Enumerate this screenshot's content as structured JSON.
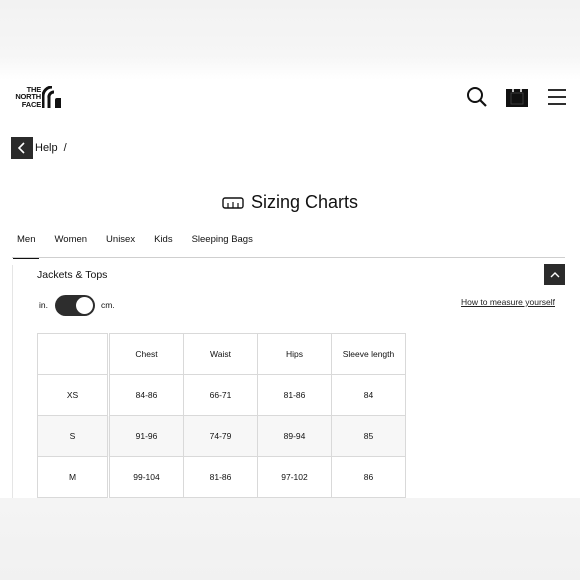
{
  "header": {
    "logo_text": "THE\nNORTH\nFACE",
    "icons": [
      "search-icon",
      "shopping-bag-icon",
      "menu-icon"
    ]
  },
  "breadcrumb": {
    "label": "Help",
    "separator": "/"
  },
  "page": {
    "title": "Sizing Charts",
    "title_icon": "ruler-icon"
  },
  "tabs": [
    {
      "label": "Men",
      "active": true
    },
    {
      "label": "Women",
      "active": false
    },
    {
      "label": "Unisex",
      "active": false
    },
    {
      "label": "Kids",
      "active": false
    },
    {
      "label": "Sleeping Bags",
      "active": false
    }
  ],
  "section": {
    "title": "Jackets & Tops",
    "unit_left": "in.",
    "unit_right": "cm.",
    "unit_selected": "cm.",
    "measure_link": "How to measure yourself"
  },
  "size_table": {
    "columns": [
      "",
      "Chest",
      "Waist",
      "Hips",
      "Sleeve length"
    ],
    "rows": [
      [
        "XS",
        "84-86",
        "66-71",
        "81-86",
        "84"
      ],
      [
        "S",
        "91-96",
        "74-79",
        "89-94",
        "85"
      ],
      [
        "M",
        "99-104",
        "81-86",
        "97-102",
        "86"
      ]
    ]
  },
  "colors": {
    "dark": "#2b2b2b",
    "border": "#d9d9d9",
    "shade": "#f7f7f7"
  }
}
